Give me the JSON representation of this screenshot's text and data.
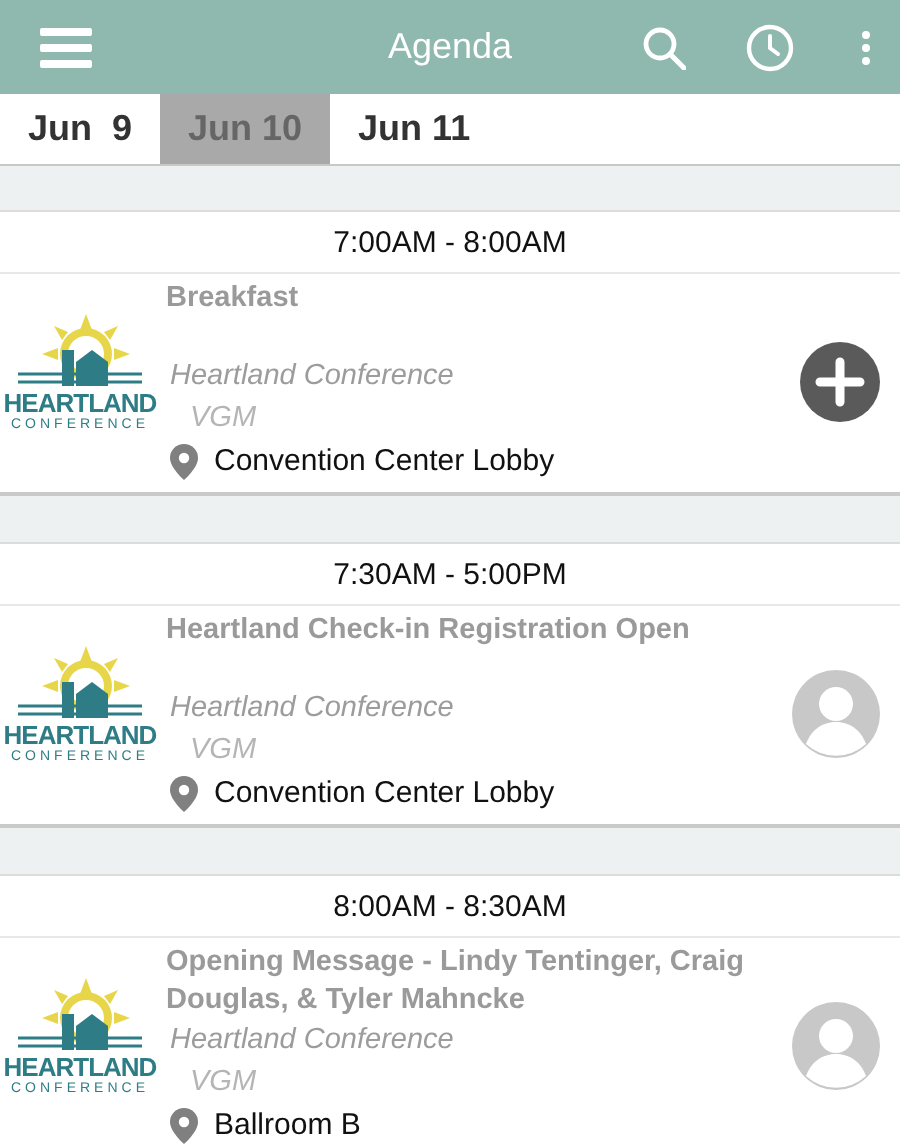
{
  "header": {
    "title": "Agenda"
  },
  "date_tabs": [
    {
      "label": "Jun  9",
      "selected": false
    },
    {
      "label": "Jun 10",
      "selected": true
    },
    {
      "label": "Jun 11",
      "selected": false
    }
  ],
  "sessions": [
    {
      "time": "7:00AM - 8:00AM",
      "title": "Breakfast",
      "logo_text": "HEARTLAND",
      "logo_subtext": "CONFERENCE",
      "event": "Heartland Conference",
      "organizer": "VGM",
      "location": "Convention Center Lobby",
      "action": {
        "kind": "add"
      }
    },
    {
      "time": "7:30AM - 5:00PM",
      "title": "Heartland Check-in Registration Open",
      "logo_text": "HEARTLAND",
      "logo_subtext": "CONFERENCE",
      "event": "Heartland Conference",
      "organizer": "VGM",
      "location": "Convention Center Lobby",
      "action": {
        "kind": "avatar"
      }
    },
    {
      "time": "8:00AM - 8:30AM",
      "title": "Opening Message - Lindy Tentinger, Craig Douglas, & Tyler Mahncke",
      "logo_text": "HEARTLAND",
      "logo_subtext": "CONFERENCE",
      "event": "Heartland Conference",
      "organizer": "VGM",
      "location": "Ballroom B",
      "action": {
        "kind": "avatar"
      }
    }
  ]
}
